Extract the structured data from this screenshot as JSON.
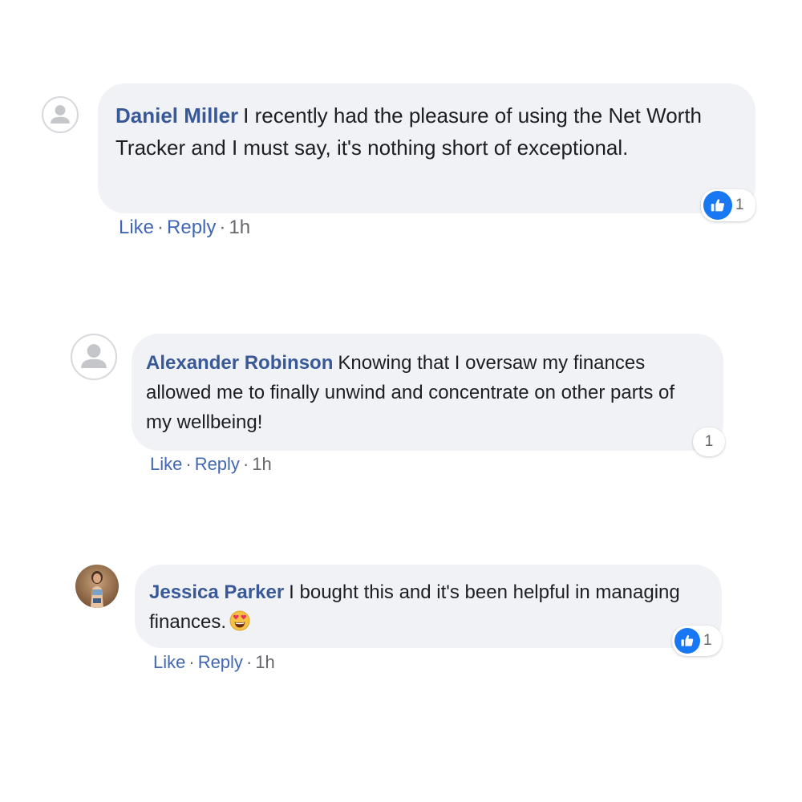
{
  "comments": [
    {
      "author": "Daniel Miller",
      "text": "I recently had the pleasure of using the Net Worth Tracker and I must say, it's nothing short of exceptional.",
      "avatar_icon": "default-profile-icon",
      "reaction": {
        "icon": "like-icon",
        "count": "1"
      },
      "actions": {
        "like": "Like",
        "reply": "Reply",
        "time": "1h"
      }
    },
    {
      "author": "Alexander Robinson",
      "text": "Knowing that I oversaw my finances allowed me to finally unwind and concentrate on other parts of my wellbeing!",
      "avatar_icon": "default-profile-icon",
      "reaction": {
        "count": "1"
      },
      "actions": {
        "like": "Like",
        "reply": "Reply",
        "time": "1h"
      }
    },
    {
      "author": "Jessica Parker",
      "text": "I bought this and it's been helpful in managing finances.",
      "emoji": "heart-eyes-emoji",
      "avatar_icon": "profile-photo",
      "reaction": {
        "icon": "like-icon",
        "count": "1"
      },
      "actions": {
        "like": "Like",
        "reply": "Reply",
        "time": "1h"
      }
    }
  ],
  "colors": {
    "author": "#385898",
    "link": "#4267b2",
    "bubble": "#f0f2f5",
    "meta": "#65676b",
    "like_badge": "#1877f2"
  }
}
